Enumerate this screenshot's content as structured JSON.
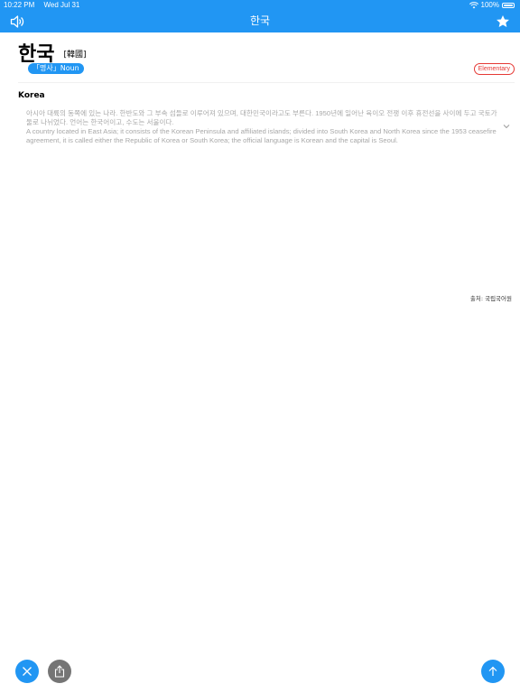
{
  "status_bar": {
    "time": "10:22 PM",
    "date": "Wed Jul 31",
    "battery": "100%"
  },
  "nav": {
    "title": "한국",
    "left_icon": "speaker-icon",
    "right_icon": "star-icon"
  },
  "entry": {
    "headword": "한국",
    "hanja": "[韓國]",
    "pos": "「명사」Noun",
    "level": "Elementary",
    "sense_title": "Korea",
    "definition_ko": "아시아 대륙의 동쪽에 있는 나라. 한반도와 그 부속 섬들로 이루어져 있으며, 대한민국이라고도 부른다. 1950년에 일어난 육이오 전쟁 이후 휴전선을 사이에 두고 국토가 둘로 나뉘었다. 언어는 한국어이고, 수도는 서울이다.",
    "definition_en": "A country located in East Asia; it consists of the Korean Peninsula and affiliated islands; divided into South Korea and North Korea since the 1953 ceasefire agreement, it is called either the Republic of Korea or South Korea; the official language is Korean and the capital is Seoul."
  },
  "source": "출처: 국립국어원",
  "colors": {
    "primary": "#2196F3",
    "level_badge": "#e53935",
    "share_button": "#757575"
  }
}
